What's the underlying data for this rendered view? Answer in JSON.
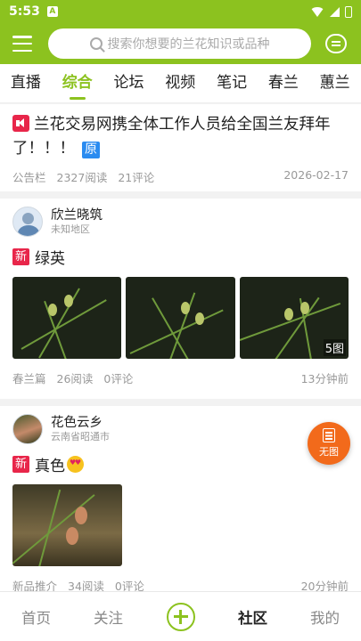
{
  "status_bar": {
    "time": "5:53",
    "notification_icon": "A"
  },
  "header": {
    "search_placeholder": "搜索你想要的兰花知识或品种",
    "colors": {
      "brand": "#8cc21f"
    }
  },
  "tabs": [
    {
      "label": "直播",
      "active": false
    },
    {
      "label": "综合",
      "active": true
    },
    {
      "label": "论坛",
      "active": false
    },
    {
      "label": "视频",
      "active": false
    },
    {
      "label": "笔记",
      "active": false
    },
    {
      "label": "春兰",
      "active": false
    },
    {
      "label": "蕙兰",
      "active": false
    }
  ],
  "posts": [
    {
      "title": "兰花交易网携全体工作人员给全国兰友拜年了！！！",
      "badge": "原",
      "category": "公告栏",
      "reads": "2327阅读",
      "comments": "21评论",
      "date": "2026-02-17"
    },
    {
      "user": "欣兰晓筑",
      "location": "未知地区",
      "new_badge": "新",
      "title": "绿英",
      "photo_count": "5图",
      "category": "春兰篇",
      "reads": "26阅读",
      "comments": "0评论",
      "time": "13分钟前"
    },
    {
      "user": "花色云乡",
      "location": "云南省昭通市",
      "new_badge": "新",
      "title": "真色",
      "category": "新品推介",
      "reads": "34阅读",
      "comments": "0评论",
      "time": "20分钟前"
    }
  ],
  "float_button": {
    "label": "无图"
  },
  "bottom_nav": [
    {
      "label": "首页",
      "active": false
    },
    {
      "label": "关注",
      "active": false
    },
    {
      "label": "",
      "icon": "plus-icon"
    },
    {
      "label": "社区",
      "active": true
    },
    {
      "label": "我的",
      "active": false
    }
  ]
}
